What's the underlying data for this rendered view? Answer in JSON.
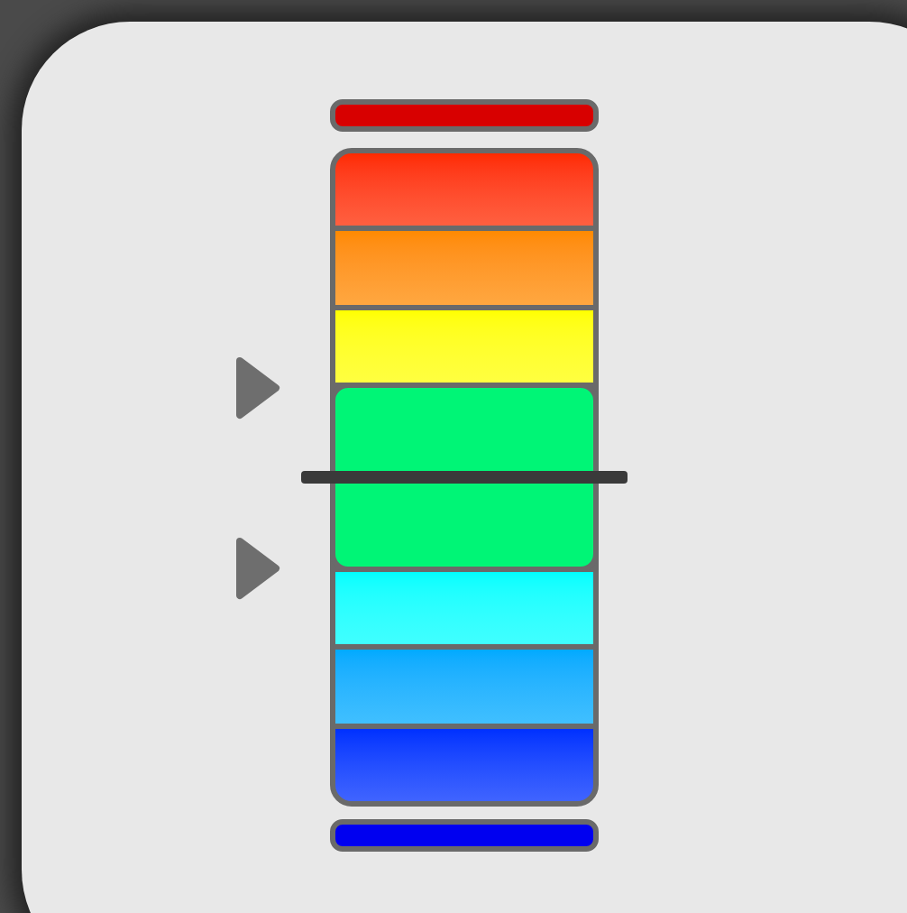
{
  "top_cap": {
    "color": "#d80000"
  },
  "meter": {
    "bands": [
      {
        "color": "#ff2a00",
        "selected": false
      },
      {
        "color": "#ff8a00",
        "selected": false
      },
      {
        "color": "#ffff00",
        "selected": false
      },
      {
        "color": "#00f576",
        "selected": true
      },
      {
        "color": "#00ffff",
        "selected": false
      },
      {
        "color": "#00aaff",
        "selected": false
      },
      {
        "color": "#0030ff",
        "selected": false
      }
    ]
  },
  "bottom_cap": {
    "color": "#0000f0"
  }
}
